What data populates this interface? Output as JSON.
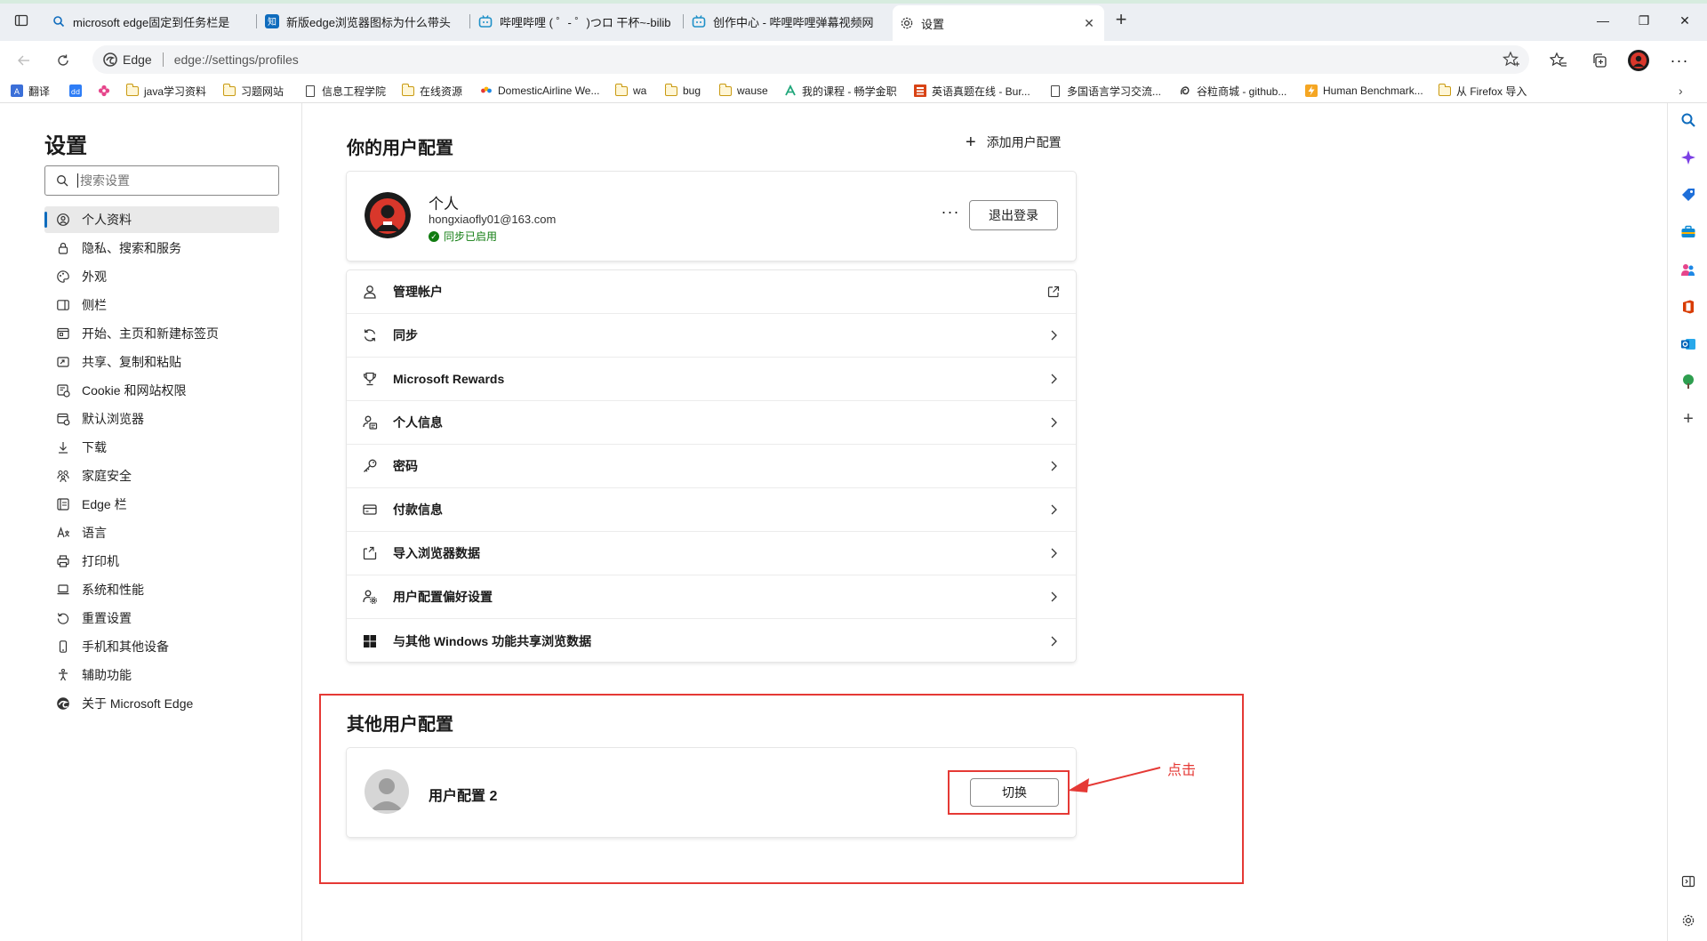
{
  "tabs": [
    {
      "title": "microsoft edge固定到任务栏是",
      "favicon": "search-icon"
    },
    {
      "title": "新版edge浏览器图标为什么带头",
      "favicon": "zhihu-icon"
    },
    {
      "title": "哔哩哔哩 ( ゜- ゜)つロ 干杯~-bilib",
      "favicon": "bilibili-icon"
    },
    {
      "title": "创作中心 - 哔哩哔哩弹幕视频网",
      "favicon": "bilibili-icon"
    },
    {
      "title": "设置",
      "favicon": "gear-icon",
      "active": true
    }
  ],
  "address_bar": {
    "site_label": "Edge",
    "url": "edge://settings/profiles"
  },
  "favorites": [
    {
      "label": "翻译",
      "icon": "translate-icon"
    },
    {
      "label": "",
      "icon": "dd-icon"
    },
    {
      "label": "",
      "icon": "flower-icon"
    },
    {
      "label": "java学习资料",
      "icon": "folder-icon"
    },
    {
      "label": "习题网站",
      "icon": "folder-icon"
    },
    {
      "label": "信息工程学院",
      "icon": "page-icon"
    },
    {
      "label": "在线资源",
      "icon": "folder-icon"
    },
    {
      "label": "DomesticAirline We...",
      "icon": "airline-icon"
    },
    {
      "label": "wa",
      "icon": "folder-icon"
    },
    {
      "label": "bug",
      "icon": "folder-icon"
    },
    {
      "label": "wause",
      "icon": "folder-icon"
    },
    {
      "label": "我的课程 - 畅学金职",
      "icon": "course-icon"
    },
    {
      "label": "英语真题在线 - Bur...",
      "icon": "english-icon"
    },
    {
      "label": "多国语言学习交流...",
      "icon": "page-icon"
    },
    {
      "label": "谷粒商城 - github...",
      "icon": "github-icon"
    },
    {
      "label": "Human Benchmark...",
      "icon": "lightning-icon"
    },
    {
      "label": "从 Firefox 导入",
      "icon": "folder-icon"
    }
  ],
  "settings": {
    "title": "设置",
    "search_placeholder": "搜索设置",
    "nav": [
      {
        "label": "个人资料",
        "icon": "profile-icon",
        "selected": true
      },
      {
        "label": "隐私、搜索和服务",
        "icon": "lock-icon"
      },
      {
        "label": "外观",
        "icon": "palette-icon"
      },
      {
        "label": "侧栏",
        "icon": "sidebar-icon"
      },
      {
        "label": "开始、主页和新建标签页",
        "icon": "home-icon"
      },
      {
        "label": "共享、复制和粘贴",
        "icon": "share-icon"
      },
      {
        "label": "Cookie 和网站权限",
        "icon": "cookie-icon"
      },
      {
        "label": "默认浏览器",
        "icon": "browser-icon"
      },
      {
        "label": "下载",
        "icon": "download-icon"
      },
      {
        "label": "家庭安全",
        "icon": "family-icon"
      },
      {
        "label": "Edge 栏",
        "icon": "edge-bar-icon"
      },
      {
        "label": "语言",
        "icon": "language-icon"
      },
      {
        "label": "打印机",
        "icon": "printer-icon"
      },
      {
        "label": "系统和性能",
        "icon": "laptop-icon"
      },
      {
        "label": "重置设置",
        "icon": "reset-icon"
      },
      {
        "label": "手机和其他设备",
        "icon": "phone-icon"
      },
      {
        "label": "辅助功能",
        "icon": "accessibility-icon"
      },
      {
        "label": "关于 Microsoft Edge",
        "icon": "edge-logo-icon"
      }
    ]
  },
  "profiles": {
    "section_title": "你的用户配置",
    "add_label": "添加用户配置",
    "current": {
      "name": "个人",
      "email": "hongxiaofly01@163.com",
      "sync_status": "同步已启用",
      "more_label": "···",
      "signout_label": "退出登录"
    },
    "menu": [
      {
        "label": "管理帐户",
        "icon": "person-icon",
        "trail": "external-link-icon"
      },
      {
        "label": "同步",
        "icon": "sync-icon",
        "trail": "chevron-right-icon"
      },
      {
        "label": "Microsoft Rewards",
        "icon": "trophy-icon",
        "trail": "chevron-right-icon"
      },
      {
        "label": "个人信息",
        "icon": "person-card-icon",
        "trail": "chevron-right-icon"
      },
      {
        "label": "密码",
        "icon": "key-icon",
        "trail": "chevron-right-icon"
      },
      {
        "label": "付款信息",
        "icon": "credit-card-icon",
        "trail": "chevron-right-icon"
      },
      {
        "label": "导入浏览器数据",
        "icon": "import-icon",
        "trail": "chevron-right-icon"
      },
      {
        "label": "用户配置偏好设置",
        "icon": "person-gear-icon",
        "trail": "chevron-right-icon"
      },
      {
        "label": "与其他 Windows 功能共享浏览数据",
        "icon": "windows-icon",
        "trail": "chevron-right-icon"
      }
    ],
    "other_title": "其他用户配置",
    "other": {
      "name": "用户配置 2",
      "switch_label": "切换"
    }
  },
  "annotation": {
    "label": "点击",
    "color": "#e53935"
  },
  "colors": {
    "accent": "#0f6cbd",
    "sync_green": "#107c10",
    "annotation_red": "#e53935"
  }
}
